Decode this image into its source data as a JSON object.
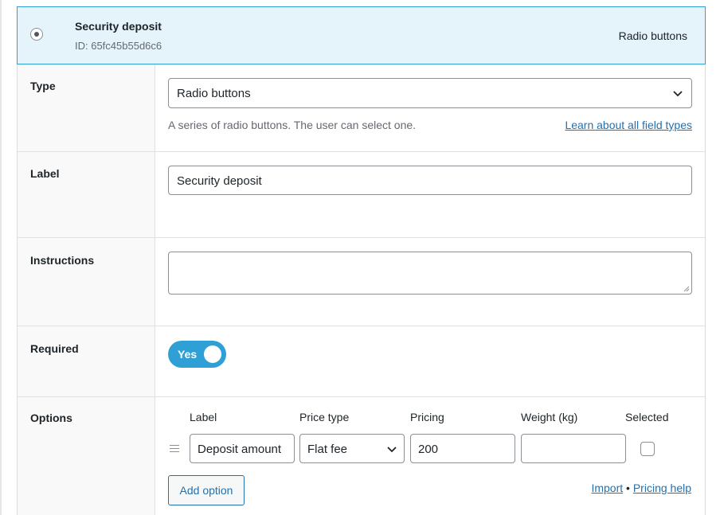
{
  "header": {
    "title": "Security deposit",
    "id_text": "ID: 65fc45b55d6c6",
    "type_label": "Radio buttons"
  },
  "type_row": {
    "label": "Type",
    "selected_value": "Radio buttons",
    "description": "A series of radio buttons. The user can select one.",
    "learn_link": "Learn about all field types"
  },
  "label_row": {
    "label": "Label",
    "value": "Security deposit"
  },
  "instructions_row": {
    "label": "Instructions",
    "value": ""
  },
  "required_row": {
    "label": "Required",
    "toggle_text": "Yes",
    "toggle_on": true
  },
  "options_row": {
    "label": "Options",
    "columns": {
      "label": "Label",
      "price_type": "Price type",
      "pricing": "Pricing",
      "weight": "Weight (kg)",
      "selected": "Selected"
    },
    "options": [
      {
        "label": "Deposit amount",
        "price_type": "Flat fee",
        "pricing": "200",
        "weight": "",
        "selected": false
      }
    ],
    "add_button": "Add option",
    "import_link": "Import",
    "separator": "•",
    "pricing_help_link": "Pricing help"
  },
  "colors": {
    "accent": "#2ea0d6",
    "link": "#2271b1",
    "header_bg": "#e5f3fb"
  }
}
